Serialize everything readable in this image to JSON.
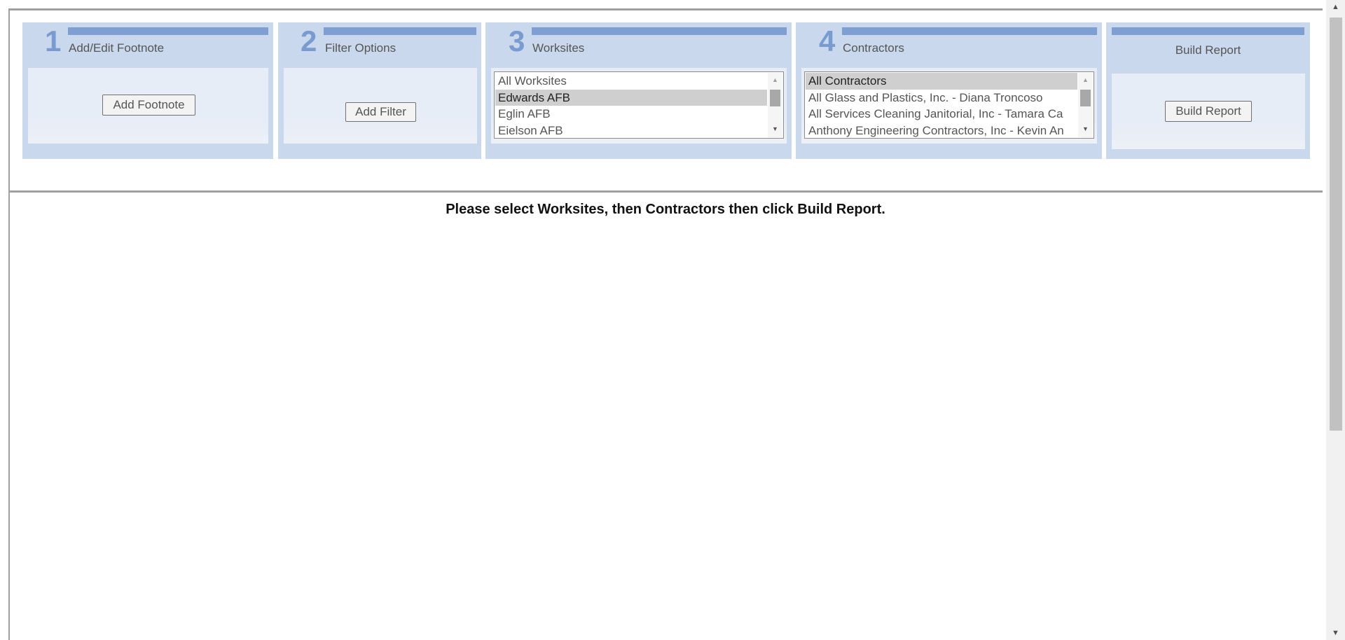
{
  "steps": {
    "footnote": {
      "number": "1",
      "title": "Add/Edit Footnote",
      "button_label": "Add Footnote"
    },
    "filter": {
      "number": "2",
      "title": "Filter Options",
      "button_label": "Add Filter"
    },
    "worksites": {
      "number": "3",
      "title": "Worksites",
      "items": [
        "All Worksites",
        "Edwards AFB",
        "Eglin AFB",
        "Eielson AFB"
      ],
      "selected": "Edwards AFB"
    },
    "contractors": {
      "number": "4",
      "title": "Contractors",
      "items": [
        "All Contractors",
        "All Glass and Plastics, Inc. - Diana Troncoso",
        "All Services Cleaning Janitorial, Inc - Tamara Ca",
        "Anthony Engineering Contractors, Inc - Kevin An"
      ],
      "selected": "All Contractors"
    },
    "build": {
      "title": "Build Report",
      "button_label": "Build Report"
    }
  },
  "message": "Please select Worksites, then Contractors then click Build Report.",
  "colors": {
    "panel_bg": "#c9d8ec",
    "accent_bar": "#7f9fd2",
    "step_number": "#7a9bd0",
    "selected_item": "#cfcfcf"
  },
  "icons": {
    "scroll_up": "triangle-up",
    "scroll_down": "triangle-down"
  }
}
